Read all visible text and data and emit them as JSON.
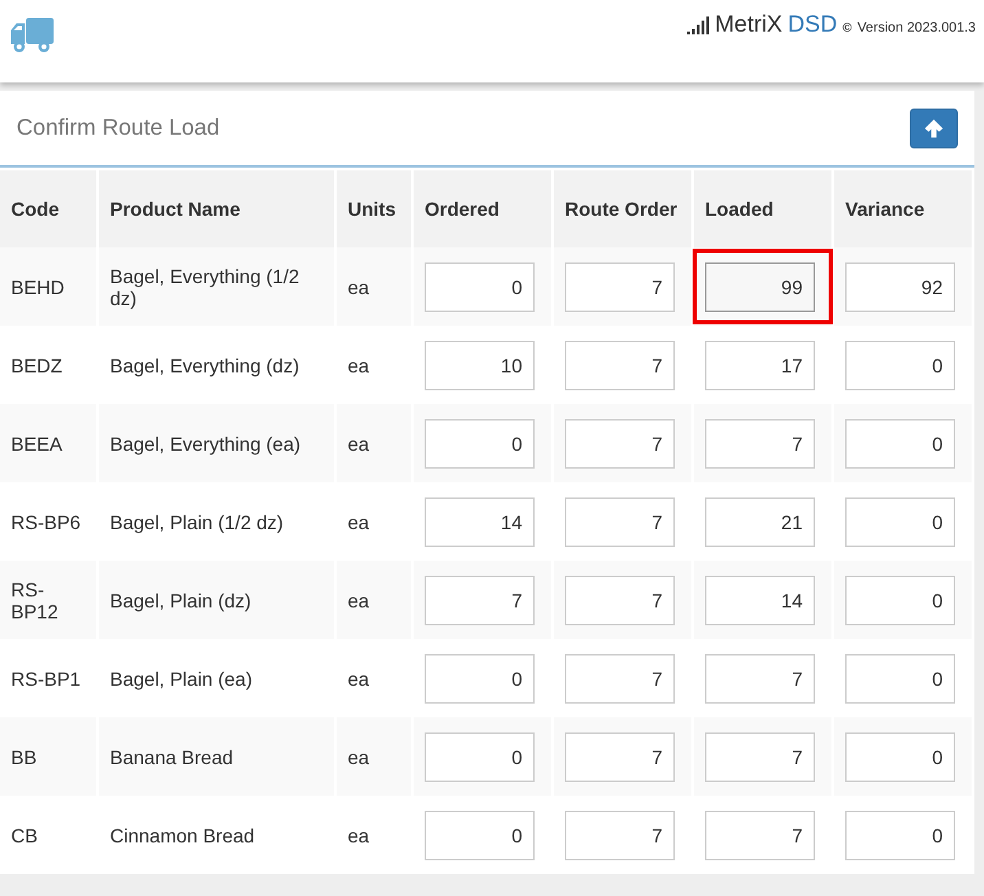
{
  "header": {
    "brand_name": "MetriX",
    "brand_suffix": "DSD",
    "copyright": "©",
    "version": "Version 2023.001.3"
  },
  "panel": {
    "title": "Confirm Route Load"
  },
  "table": {
    "columns": [
      "Code",
      "Product Name",
      "Units",
      "Ordered",
      "Route Order",
      "Loaded",
      "Variance"
    ],
    "rows": [
      {
        "code": "BEHD",
        "product": "Bagel, Everything (1/2 dz)",
        "units": "ea",
        "ordered": "0",
        "route_order": "7",
        "loaded": "99",
        "variance": "92",
        "loaded_focused": true,
        "loaded_highlighted": true
      },
      {
        "code": "BEDZ",
        "product": "Bagel, Everything (dz)",
        "units": "ea",
        "ordered": "10",
        "route_order": "7",
        "loaded": "17",
        "variance": "0",
        "loaded_focused": false,
        "loaded_highlighted": false
      },
      {
        "code": "BEEA",
        "product": "Bagel, Everything (ea)",
        "units": "ea",
        "ordered": "0",
        "route_order": "7",
        "loaded": "7",
        "variance": "0",
        "loaded_focused": false,
        "loaded_highlighted": false
      },
      {
        "code": "RS-BP6",
        "product": "Bagel, Plain (1/2 dz)",
        "units": "ea",
        "ordered": "14",
        "route_order": "7",
        "loaded": "21",
        "variance": "0",
        "loaded_focused": false,
        "loaded_highlighted": false
      },
      {
        "code": "RS-BP12",
        "product": "Bagel, Plain (dz)",
        "units": "ea",
        "ordered": "7",
        "route_order": "7",
        "loaded": "14",
        "variance": "0",
        "loaded_focused": false,
        "loaded_highlighted": false
      },
      {
        "code": "RS-BP1",
        "product": "Bagel, Plain (ea)",
        "units": "ea",
        "ordered": "0",
        "route_order": "7",
        "loaded": "7",
        "variance": "0",
        "loaded_focused": false,
        "loaded_highlighted": false
      },
      {
        "code": "BB",
        "product": "Banana Bread",
        "units": "ea",
        "ordered": "0",
        "route_order": "7",
        "loaded": "7",
        "variance": "0",
        "loaded_focused": false,
        "loaded_highlighted": false
      },
      {
        "code": "CB",
        "product": "Cinnamon Bread",
        "units": "ea",
        "ordered": "0",
        "route_order": "7",
        "loaded": "7",
        "variance": "0",
        "loaded_focused": false,
        "loaded_highlighted": false
      }
    ]
  }
}
